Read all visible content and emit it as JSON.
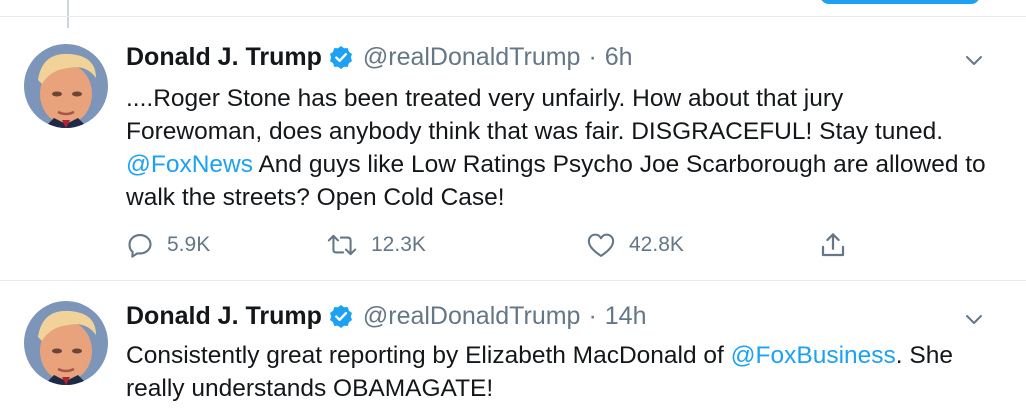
{
  "tweets": [
    {
      "name": "Donald J. Trump",
      "handle": "@realDonaldTrump",
      "separator": "·",
      "time": "6h",
      "text_before": "....Roger Stone has been treated very unfairly. How about that jury Forewoman, does anybody think that was fair. DISGRACEFUL! Stay tuned.  ",
      "mention": "@FoxNews",
      "text_after": " And guys like Low Ratings Psycho Joe Scarborough are allowed to walk the streets? Open Cold Case!",
      "replies": "5.9K",
      "retweets": "12.3K",
      "likes": "42.8K"
    },
    {
      "name": "Donald J. Trump",
      "handle": "@realDonaldTrump",
      "separator": "·",
      "time": "14h",
      "text_before": "Consistently great reporting by Elizabeth MacDonald of ",
      "mention": "@FoxBusiness",
      "text_after": ". She really understands OBAMAGATE!"
    }
  ],
  "colors": {
    "link": "#1da1f2",
    "text": "#14171a",
    "secondary": "#657786",
    "divider": "#e6ecf0",
    "verified": "#1da1f2"
  },
  "icons": [
    "verified-badge-icon",
    "chevron-down-icon",
    "reply-icon",
    "retweet-icon",
    "like-icon",
    "share-icon"
  ]
}
